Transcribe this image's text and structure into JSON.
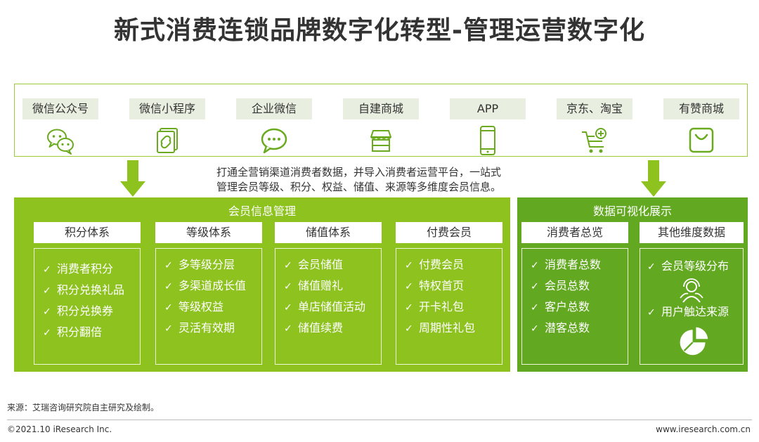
{
  "title": "新式消费连锁品牌数字化转型-管理运营数字化",
  "channels": [
    {
      "label": "微信公众号",
      "icon": "wechat-chat-icon"
    },
    {
      "label": "微信小程序",
      "icon": "mini-program-icon"
    },
    {
      "label": "企业微信",
      "icon": "enterprise-wechat-icon"
    },
    {
      "label": "自建商城",
      "icon": "storefront-icon"
    },
    {
      "label": "APP",
      "icon": "smartphone-icon"
    },
    {
      "label": "京东、淘宝",
      "icon": "shopping-cart-icon"
    },
    {
      "label": "有赞商城",
      "icon": "shopping-bag-icon"
    }
  ],
  "description": {
    "line1": "打通全营销渠道消费者数据，并导入消费者运营平台，一站式",
    "line2": "管理会员等级、积分、权益、储值、来源等多维度会员信息。"
  },
  "member_panel": {
    "title": "会员信息管理",
    "columns": [
      {
        "title": "积分体系",
        "items": [
          "消费者积分",
          "积分兑换礼品",
          "积分兑换券",
          "积分翻倍"
        ]
      },
      {
        "title": "等级体系",
        "items": [
          "多等级分层",
          "多渠道成长值",
          "等级权益",
          "灵活有效期"
        ]
      },
      {
        "title": "储值体系",
        "items": [
          "会员储值",
          "储值赠礼",
          "单店储值活动",
          "储值续费"
        ]
      },
      {
        "title": "付费会员",
        "items": [
          "付费会员",
          "特权首页",
          "开卡礼包",
          "周期性礼包"
        ]
      }
    ]
  },
  "viz_panel": {
    "title": "数据可视化展示",
    "columns": [
      {
        "title": "消费者总览",
        "items": [
          "消费者总数",
          "会员总数",
          "客户总数",
          "潜客总数"
        ]
      },
      {
        "title": "其他维度数据",
        "items": [
          "会员等级分布",
          "用户触达来源"
        ]
      }
    ]
  },
  "check_mark": "✓",
  "colors": {
    "light_green": "#8dc21f",
    "dark_green": "#62a820",
    "label_bg": "#e8eee0"
  },
  "source": "来源：艾瑞咨询研究院自主研究及绘制。",
  "copyright": "©2021.10 iResearch Inc.",
  "website": "www.iresearch.com.cn"
}
